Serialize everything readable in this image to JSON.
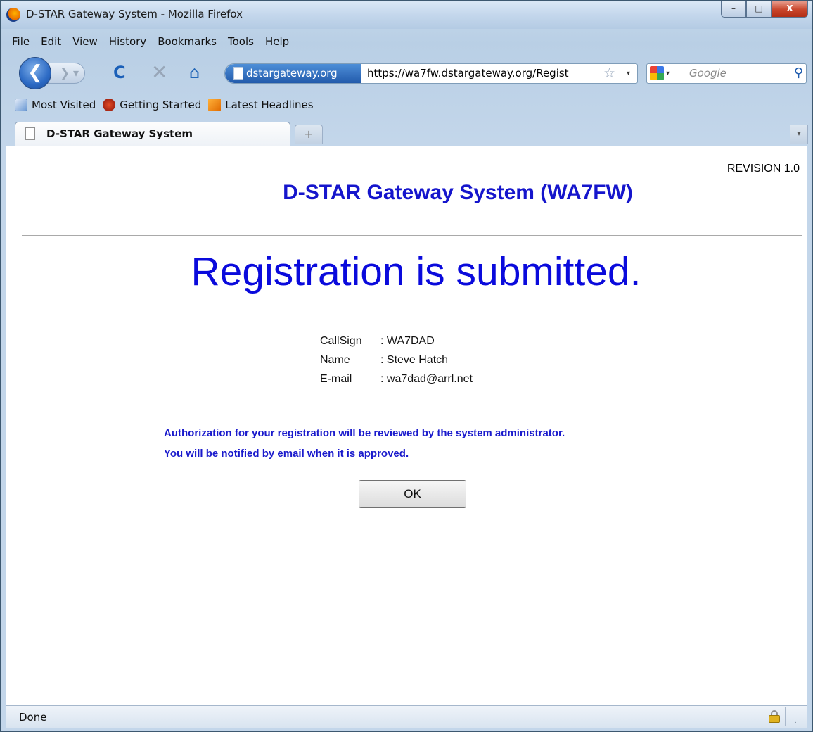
{
  "window": {
    "title": "D-STAR Gateway System - Mozilla Firefox",
    "buttons": {
      "minimize": "–",
      "maximize": "□",
      "close": "X"
    }
  },
  "menu": [
    {
      "key": "file",
      "underline": "F",
      "rest": "ile"
    },
    {
      "key": "edit",
      "underline": "E",
      "rest": "dit"
    },
    {
      "key": "view",
      "underline": "V",
      "rest": "iew"
    },
    {
      "key": "history",
      "pre": "Hi",
      "underline": "s",
      "rest": "tory"
    },
    {
      "key": "bookmarks",
      "underline": "B",
      "rest": "ookmarks"
    },
    {
      "key": "tools",
      "underline": "T",
      "rest": "ools"
    },
    {
      "key": "help",
      "underline": "H",
      "rest": "elp"
    }
  ],
  "toolbar": {
    "back_glyph": "❮",
    "forward_glyph": "❯ ▾",
    "reload_glyph": "C",
    "stop_glyph": "✕",
    "home_glyph": "⌂",
    "site_identity": "dstargateway.org",
    "url": "https://wa7fw.dstargateway.org/Regist",
    "star_glyph": "☆",
    "dropdown_glyph": "▾",
    "search_placeholder": "Google",
    "search_glyph": "⚲"
  },
  "bookmarks": [
    {
      "label": "Most Visited",
      "icon": "most-visited-icon"
    },
    {
      "label": "Getting Started",
      "icon": "firefox-icon"
    },
    {
      "label": "Latest Headlines",
      "icon": "rss-icon"
    }
  ],
  "tabs": {
    "active_title": "D-STAR Gateway System",
    "newtab_glyph": "+",
    "list_glyph": "▾"
  },
  "page": {
    "revision": "REVISION 1.0",
    "title": "D-STAR Gateway System (WA7FW)",
    "headline": "Registration is submitted.",
    "details": [
      {
        "label": "CallSign",
        "value": ": WA7DAD"
      },
      {
        "label": "Name",
        "value": ": Steve Hatch"
      },
      {
        "label": "E-mail",
        "value": ": wa7dad@arrl.net"
      }
    ],
    "notice_line1": "Authorization for your registration will be reviewed by the system administrator.",
    "notice_line2": "You will be notified by email when it is approved.",
    "ok_label": "OK"
  },
  "status": {
    "text": "Done"
  }
}
